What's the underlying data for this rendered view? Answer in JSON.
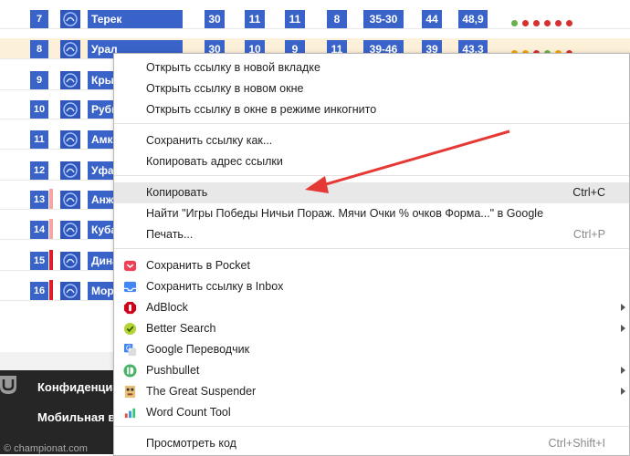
{
  "table": {
    "rows": [
      {
        "pos": "7",
        "team": "Терек",
        "g": "30",
        "w": "11",
        "d": "11",
        "l": "8",
        "goals": "35-30",
        "pts": "44",
        "pct": "48,9",
        "form": [
          "#6ab04c",
          "#d63031",
          "#d63031",
          "#d63031",
          "#d63031",
          "#d63031"
        ]
      },
      {
        "pos": "8",
        "team": "Урал",
        "g": "30",
        "w": "10",
        "d": "9",
        "l": "11",
        "goals": "39-46",
        "pts": "39",
        "pct": "43,3",
        "form": [
          "#f0a500",
          "#f0a500",
          "#d63031",
          "#6ab04c",
          "#f0a500",
          "#d63031"
        ]
      },
      {
        "pos": "9",
        "team": "Крылья Советов",
        "g": "",
        "w": "",
        "d": "",
        "l": "",
        "goals": "",
        "pts": "",
        "pct": ""
      },
      {
        "pos": "10",
        "team": "Рубин",
        "g": "",
        "w": "",
        "d": "",
        "l": "",
        "goals": "",
        "pts": "",
        "pct": ""
      },
      {
        "pos": "11",
        "team": "Амкар",
        "g": "",
        "w": "",
        "d": "",
        "l": "",
        "goals": "",
        "pts": "",
        "pct": ""
      },
      {
        "pos": "12",
        "team": "Уфа",
        "g": "",
        "w": "",
        "d": "",
        "l": "",
        "goals": "",
        "pts": "",
        "pct": ""
      },
      {
        "pos": "13",
        "team": "Анжи",
        "g": "",
        "w": "",
        "d": "",
        "l": "",
        "goals": "",
        "pts": "",
        "pct": ""
      },
      {
        "pos": "14",
        "team": "Кубань",
        "g": "",
        "w": "",
        "d": "",
        "l": "",
        "goals": "",
        "pts": "",
        "pct": ""
      },
      {
        "pos": "15",
        "team": "Динамо",
        "g": "",
        "w": "",
        "d": "",
        "l": "",
        "goals": "",
        "pts": "",
        "pct": ""
      },
      {
        "pos": "16",
        "team": "Мордовия",
        "g": "",
        "w": "",
        "d": "",
        "l": "",
        "goals": "",
        "pts": "",
        "pct": ""
      }
    ]
  },
  "footer": {
    "link1": "Конфиденциальность",
    "link2": "Мобильная версия",
    "copyright": "© championat.com"
  },
  "menu": {
    "open_new_tab": "Открыть ссылку в новой вкладке",
    "open_new_window": "Открыть ссылку в новом окне",
    "open_incognito": "Открыть ссылку в окне в режиме инкогнито",
    "save_link": "Сохранить ссылку как...",
    "copy_link": "Копировать адрес ссылки",
    "copy": "Копировать",
    "copy_shortcut": "Ctrl+C",
    "search_google": "Найти \"Игры Победы Ничьи Пораж. Мячи Очки % очков Форма...\" в Google",
    "print": "Печать...",
    "print_shortcut": "Ctrl+P",
    "pocket": "Сохранить в Pocket",
    "inbox": "Сохранить ссылку в Inbox",
    "adblock": "AdBlock",
    "better_search": "Better Search",
    "translate": "Google Переводчик",
    "pushbullet": "Pushbullet",
    "suspender": "The Great Suspender",
    "word_count": "Word Count Tool",
    "inspect": "Просмотреть код",
    "inspect_shortcut": "Ctrl+Shift+I"
  }
}
